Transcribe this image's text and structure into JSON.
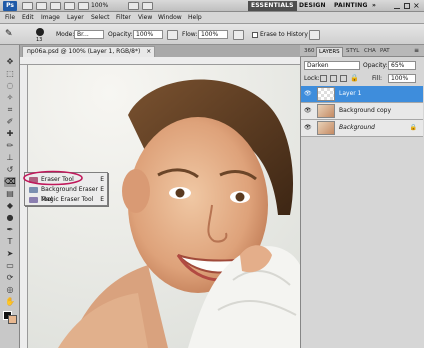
{
  "app": {
    "logo": "Ps",
    "zoom": "100%",
    "workspaces": [
      "ESSENTIALS",
      "DESIGN",
      "PAINTING",
      "»"
    ]
  },
  "menu": [
    "File",
    "Edit",
    "Image",
    "Layer",
    "Select",
    "Filter",
    "View",
    "Window",
    "Help"
  ],
  "options": {
    "mode_label": "Mode:",
    "mode_value": "Br...",
    "opacity_label": "Opacity:",
    "opacity_value": "100%",
    "flow_label": "Flow:",
    "flow_value": "100%",
    "erase_history_label": "Erase to History",
    "brush_size": "13"
  },
  "document": {
    "tab_title": "пр06a.psd @ 100% (Layer 1, RGB/8*)",
    "tab_close": "×"
  },
  "flyout": {
    "items": [
      {
        "label": "Eraser Tool",
        "key": "E"
      },
      {
        "label": "Background Eraser Tool",
        "key": "E"
      },
      {
        "label": "Magic Eraser Tool",
        "key": "E"
      }
    ]
  },
  "panel": {
    "tabs": [
      "360",
      "LAYERS",
      "STYL",
      "CHA",
      "PAT"
    ],
    "blend_mode": "Darken",
    "opacity_label": "Opacity:",
    "opacity_value": "65%",
    "lock_label": "Lock:",
    "fill_label": "Fill:",
    "fill_value": "100%",
    "layers": [
      {
        "name": "Layer 1",
        "selected": true
      },
      {
        "name": "Background copy",
        "selected": false
      },
      {
        "name": "Background",
        "selected": false
      }
    ]
  },
  "colors": {
    "selection": "#3e8ddc",
    "highlight_circle": "#c0185a",
    "workspace_active": "#4e4e4e"
  }
}
